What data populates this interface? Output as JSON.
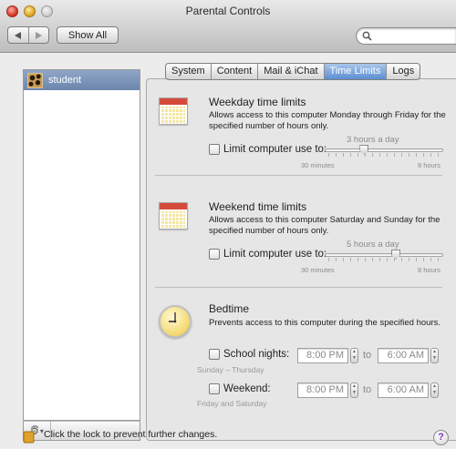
{
  "window": {
    "title": "Parental Controls"
  },
  "toolbar": {
    "back_icon": "triangle-left",
    "forward_icon": "triangle-right",
    "show_all_label": "Show All",
    "search_placeholder": ""
  },
  "users": [
    {
      "name": "student",
      "selected": true
    }
  ],
  "tabs": [
    {
      "label": "System",
      "active": false
    },
    {
      "label": "Content",
      "active": false
    },
    {
      "label": "Mail & iChat",
      "active": false
    },
    {
      "label": "Time Limits",
      "active": true
    },
    {
      "label": "Logs",
      "active": false
    }
  ],
  "weekday": {
    "title": "Weekday time limits",
    "description": "Allows access to this computer Monday through Friday for the specified number of hours only.",
    "checkbox_label": "Limit computer use to:",
    "checked": false,
    "value_label": "3 hours a day",
    "value_hours": 3,
    "min_label": "30 minutes",
    "max_label": "8 hours"
  },
  "weekend": {
    "title": "Weekend time limits",
    "description": "Allows access to this computer Saturday and Sunday for the specified number of hours only.",
    "checkbox_label": "Limit computer use to:",
    "checked": false,
    "value_label": "5 hours a day",
    "value_hours": 5,
    "min_label": "30 minutes",
    "max_label": "8 hours"
  },
  "bedtime": {
    "title": "Bedtime",
    "description": "Prevents access to this computer during the specified hours.",
    "school_nights": {
      "label": "School nights:",
      "sub_label": "Sunday – Thursday",
      "from": "8:00 PM",
      "to_label": "to",
      "to": "6:00 AM",
      "checked": false
    },
    "weekend": {
      "label": "Weekend:",
      "sub_label": "Friday and Saturday",
      "from": "8:00 PM",
      "to_label": "to",
      "to": "6:00 AM",
      "checked": false
    }
  },
  "footer": {
    "lock_text": "Click the lock to prevent further changes.",
    "help_label": "?"
  },
  "colors": {
    "selection": "#7088ae",
    "tab_active": "#5d8fd3",
    "calendar_header": "#d44b3c"
  }
}
